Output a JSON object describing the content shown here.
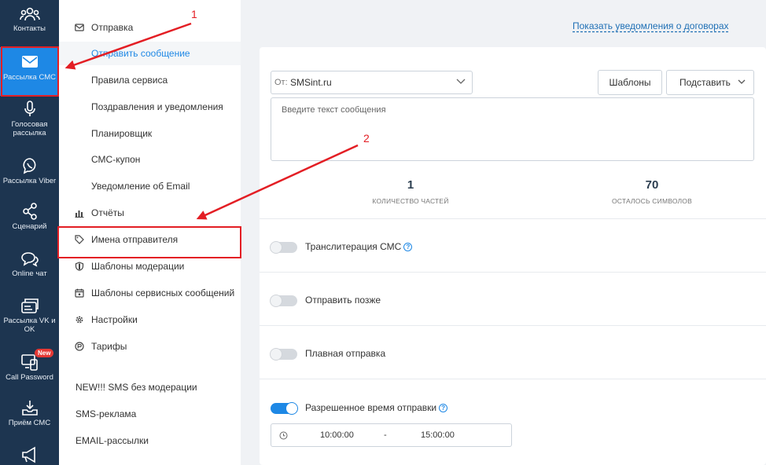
{
  "rail": {
    "items": [
      {
        "label": "Контакты",
        "icon": "contacts-icon"
      },
      {
        "label": "Рассылка СМС",
        "icon": "envelope-icon"
      },
      {
        "label": "Голосовая рассылка",
        "icon": "microphone-icon"
      },
      {
        "label": "Рассылка Viber",
        "icon": "viber-icon"
      },
      {
        "label": "Сценарий",
        "icon": "share-nodes-icon"
      },
      {
        "label": "Online чат",
        "icon": "chat-icon"
      },
      {
        "label": "Рассылка VK и OK",
        "icon": "social-post-icon"
      },
      {
        "label": "Call Password",
        "icon": "phone-screen-icon",
        "badge": "New"
      },
      {
        "label": "Приём СМС",
        "icon": "inbox-download-icon"
      },
      {
        "label": "",
        "icon": "megaphone-icon"
      }
    ]
  },
  "submenu": {
    "send_section": "Отправка",
    "send_items": [
      "Отправить сообщение",
      "Правила сервиса",
      "Поздравления и уведомления",
      "Планировщик",
      "СМС-купон",
      "Уведомление об Email"
    ],
    "reports": "Отчёты",
    "sender_names": "Имена отправителя",
    "moderation_templates": "Шаблоны модерации",
    "service_templates": "Шаблоны сервисных сообщений",
    "settings": "Настройки",
    "tariffs": "Тарифы",
    "extra_links": [
      "NEW!!! SMS без модерации",
      "SMS-реклама",
      "EMAIL-рассылки"
    ]
  },
  "main": {
    "contracts_link": "Показать уведомления о договорах",
    "from_prefix": "От:",
    "from_value": "SMSint.ru",
    "templates_button": "Шаблоны",
    "insert_button": "Подставить",
    "message_placeholder": "Введите текст сообщения",
    "parts_count": "1",
    "parts_label": "КОЛИЧЕСТВО ЧАСТЕЙ",
    "chars_left": "70",
    "chars_left_label": "ОСТАЛОСЬ СИМВОЛОВ",
    "options": [
      {
        "label": "Транслитерация СМС",
        "on": false,
        "help": true
      },
      {
        "label": "Отправить позже",
        "on": false,
        "help": false
      },
      {
        "label": "Плавная отправка",
        "on": false,
        "help": false
      },
      {
        "label": "Разрешенное время отправки",
        "on": true,
        "help": true
      }
    ],
    "time_from": "10:00:00",
    "time_separator": "-",
    "time_to": "15:00:00"
  },
  "annotations": {
    "label_1": "1",
    "label_2": "2",
    "color": "#e31e24"
  },
  "colors": {
    "rail_bg": "#1d3550",
    "accent": "#1e88e5",
    "active_rail": "#1e88e5"
  }
}
